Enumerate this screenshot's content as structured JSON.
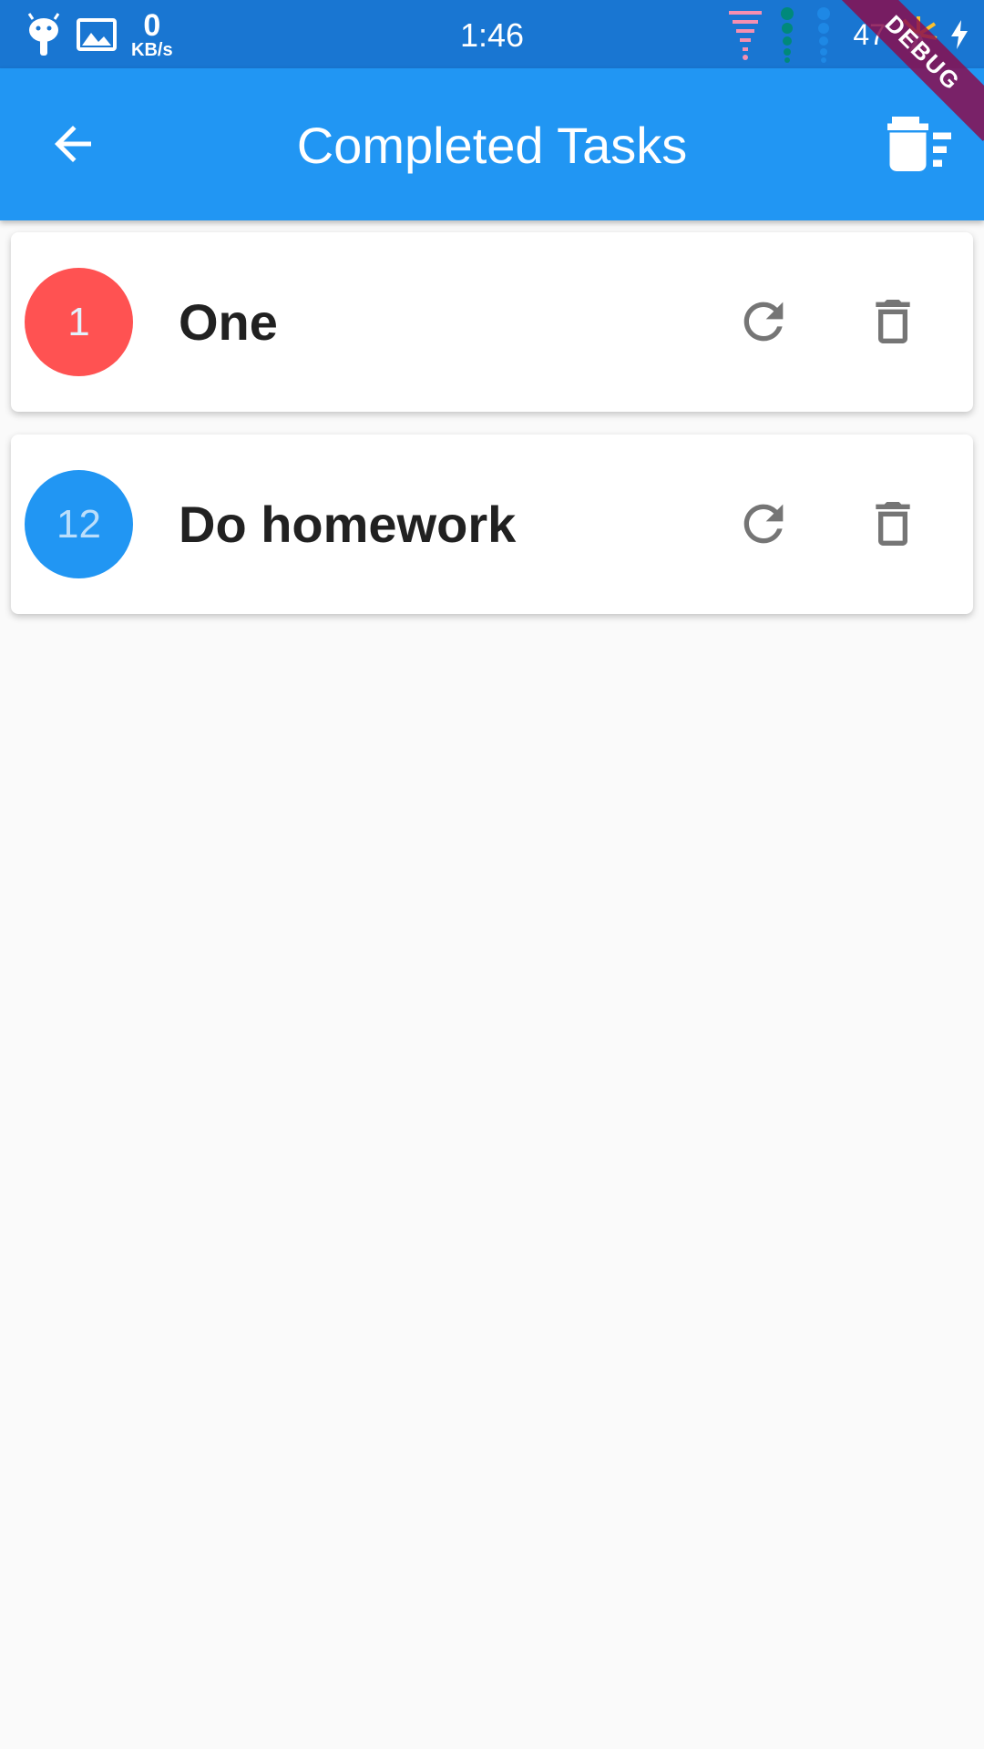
{
  "status_bar": {
    "speed_value": "0",
    "speed_unit": "KB/s",
    "time": "1:46",
    "battery": "47"
  },
  "debug_banner": "DEBUG",
  "app_bar": {
    "title": "Completed Tasks",
    "back_icon": "arrow-back-icon",
    "action_icon": "delete-sweep-icon"
  },
  "tasks": [
    {
      "badge": "1",
      "title": "One",
      "badge_color": "#ff5252",
      "badge_text_color": "#e3f2fd"
    },
    {
      "badge": "12",
      "title": "Do homework",
      "badge_color": "#2196f3",
      "badge_text_color": "#bbdefb"
    }
  ],
  "colors": {
    "status_bar": "#1976d2",
    "app_bar": "#2196f3",
    "icon_gray": "#757575",
    "background": "#fafafa"
  }
}
